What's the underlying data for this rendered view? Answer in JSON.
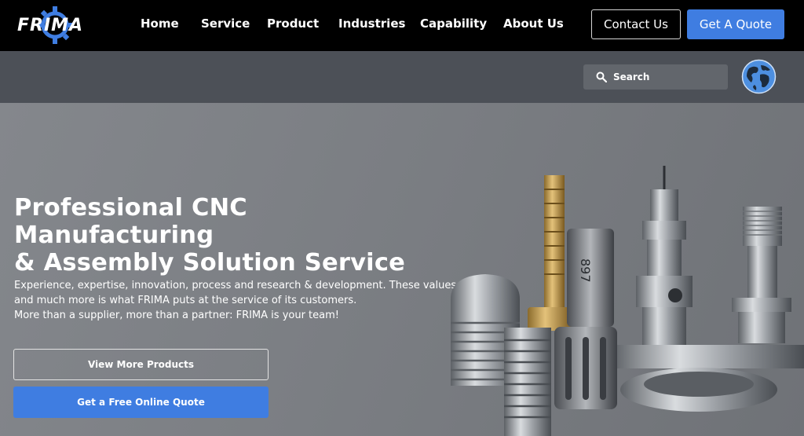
{
  "header": {
    "logo_text": "FRIMA",
    "nav": [
      {
        "label": "Home"
      },
      {
        "label": "Service"
      },
      {
        "label": "Product"
      },
      {
        "label": "Industries"
      },
      {
        "label": "Capability"
      },
      {
        "label": "About Us"
      }
    ],
    "contact_label": "Contact Us",
    "quote_label": "Get A Quote"
  },
  "subbar": {
    "search_placeholder": "Search",
    "language_icon": "globe-icon"
  },
  "hero": {
    "title_line1": "Professional CNC Manufacturing",
    "title_line2": "& Assembly Solution Service",
    "desc_line1": "Experience, expertise, innovation, process and research & development. These values",
    "desc_line2": "and much more is what FRIMA puts at the service of its customers.",
    "desc_line3": "More than a supplier, more than a partner: FRIMA is your team!",
    "view_products_label": "View More Products",
    "free_quote_label": "Get a Free Online Quote",
    "part_engraving": "897"
  },
  "colors": {
    "accent": "#3f7de1",
    "nav_bg": "#000000",
    "subbar_bg": "#4c5057"
  }
}
